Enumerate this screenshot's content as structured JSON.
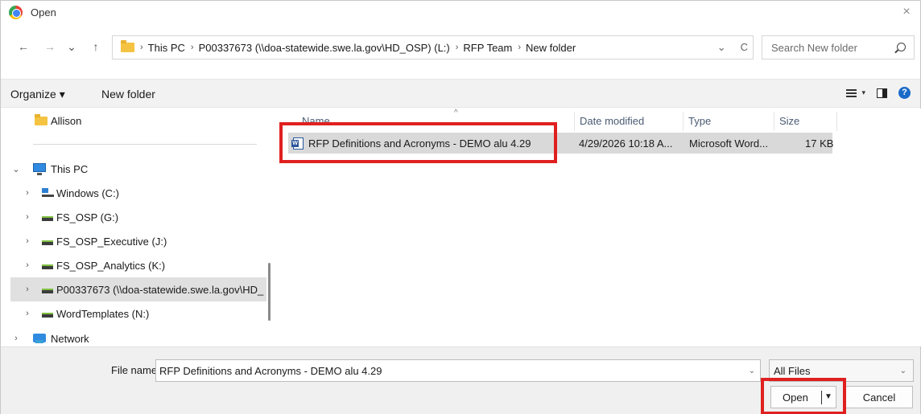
{
  "window": {
    "title": "Open",
    "close_glyph": "×"
  },
  "nav": {
    "back": "←",
    "forward": "→",
    "recent": "⌄",
    "up": "↑",
    "breadcrumbs": [
      "This PC",
      "P00337673 (\\\\doa-statewide.swe.la.gov\\HD_OSP) (L:)",
      "RFP Team",
      "New folder"
    ],
    "crumb_sep": "›",
    "address_dropdown": "⌄",
    "refresh": "C",
    "search_placeholder": "Search New folder"
  },
  "toolbar": {
    "organize": "Organize ▾",
    "new_folder": "New folder",
    "view_caret": "▾",
    "help": "?"
  },
  "tree": [
    {
      "label": "Allison",
      "icon": "folder-icon",
      "chev": ""
    },
    {
      "label": "This PC",
      "icon": "pc-icon",
      "chev": "⌄"
    },
    {
      "label": "Windows (C:)",
      "icon": "windows-drive-icon",
      "chev": "›"
    },
    {
      "label": "FS_OSP (G:)",
      "icon": "network-drive-icon",
      "chev": "›"
    },
    {
      "label": "FS_OSP_Executive (J:)",
      "icon": "network-drive-icon",
      "chev": "›"
    },
    {
      "label": "FS_OSP_Analytics (K:)",
      "icon": "network-drive-icon",
      "chev": "›"
    },
    {
      "label": "P00337673 (\\\\doa-statewide.swe.la.gov\\HD_",
      "icon": "network-drive-icon",
      "chev": "›"
    },
    {
      "label": "WordTemplates (N:)",
      "icon": "network-drive-icon",
      "chev": "›"
    },
    {
      "label": "Network",
      "icon": "network-icon",
      "chev": "›"
    }
  ],
  "columns": {
    "name": "Name",
    "date": "Date modified",
    "type": "Type",
    "size": "Size",
    "sort_glyph": "^"
  },
  "files": [
    {
      "name": "RFP Definitions and Acronyms - DEMO alu 4.29",
      "date": "4/29/2026 10:18 A...",
      "type": "Microsoft Word...",
      "size": "17 KB"
    }
  ],
  "bottom": {
    "file_name_label": "File name:",
    "file_name_value": "RFP Definitions and Acronyms - DEMO alu 4.29",
    "fn_chev": "⌄",
    "filter": "All Files",
    "filter_chev": "⌄",
    "open": "Open",
    "open_arrow": "▼",
    "cancel": "Cancel"
  },
  "colors": {
    "highlight_red": "#e02020",
    "selected_row": "#d9d9d9",
    "accent": "#1b6ac9"
  }
}
